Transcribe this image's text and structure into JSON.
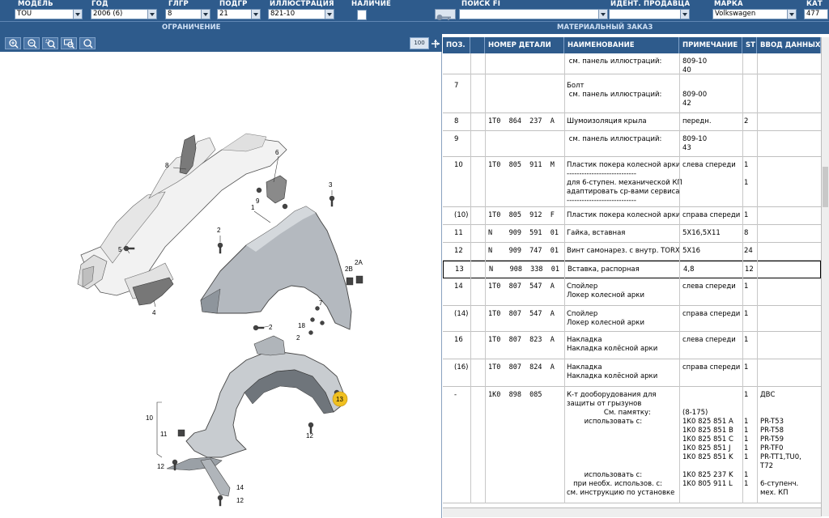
{
  "filters": {
    "model": {
      "label": "МОДЕЛЬ",
      "value": "TOU"
    },
    "year": {
      "label": "ГОД",
      "value": "2006 (6)"
    },
    "group": {
      "label": "ГЛГР",
      "value": "8"
    },
    "subgroup": {
      "label": "ПОДГР",
      "value": "21"
    },
    "illustration": {
      "label": "ИЛЛЮСТРАЦИЯ",
      "value": "821-10"
    },
    "availability": {
      "label": "НАЛИЧИЕ"
    },
    "search_fi": {
      "label": "ПОИСК FI",
      "value": ""
    },
    "seller_id": {
      "label": "ИДЕНТ. ПРОДАВЦА",
      "value": ""
    },
    "brand": {
      "label": "МАРКА",
      "value": "Volkswagen"
    },
    "catalog": {
      "label": "КАТ",
      "value": "477"
    }
  },
  "sections": {
    "left": "ОГРАНИЧЕНИЕ",
    "right": "МАТЕРИАЛЬНЫЙ ЗАКАЗ"
  },
  "zoom_toolbar": {
    "page_indicator": "100"
  },
  "table": {
    "headers": {
      "pos": "ПОЗ.",
      "part": "НОМЕР ДЕТАЛИ",
      "name": "НАИМЕНОВАНИЕ",
      "note": "ПРИМЕЧАНИЕ",
      "qty": "ST",
      "input": "ВВОД ДАННЫХ ПО"
    },
    "rows": [
      {
        "pos": "",
        "part": "",
        "name": " см. панель иллюстраций:",
        "note": "809-10\n40",
        "qty": "",
        "input": ""
      },
      {
        "pos": "7",
        "part": "",
        "name": "Болт\n см. панель иллюстраций:",
        "note": "\n809-00\n42",
        "qty": "",
        "input": ""
      },
      {
        "pos": "8",
        "part": "1T0  864  237  A",
        "name": "Шумоизоляция крыла",
        "note": "передн.",
        "qty": "2",
        "input": ""
      },
      {
        "pos": "9",
        "part": "",
        "name": " см. панель иллюстраций:",
        "note": "809-10\n43",
        "qty": "",
        "input": ""
      },
      {
        "pos": "10",
        "part": "1T0  805  911  M",
        "name": "Пластик покера колесной арки\n----------------------------\nдля 6-ступен. механической КП\nадаптировать ср-вами сервиса\n----------------------------",
        "note": "слева спереди",
        "qty": "1\n\n1",
        "input": ""
      },
      {
        "pos": "(10)",
        "part": "1T0  805  912  F",
        "name": "Пластик покера колесной арки",
        "note": "справа спереди",
        "qty": "1",
        "input": ""
      },
      {
        "pos": "11",
        "part": "N    909  591  01",
        "name": "Гайка, вставная",
        "note": "5X16,5X11",
        "qty": "8",
        "input": ""
      },
      {
        "pos": "12",
        "part": "N    909  747  01",
        "name": "Винт самонарез. с внутр. TORX",
        "note": "5X16",
        "qty": "24",
        "input": ""
      },
      {
        "pos": "13",
        "part": "N    908  338  01",
        "name": "Вставка, распорная",
        "note": "4,8",
        "qty": "12",
        "input": ""
      },
      {
        "pos": "14",
        "part": "1T0  807  547  A",
        "name": "Спойлер\nЛокер колесной арки",
        "note": "слева спереди",
        "qty": "1",
        "input": ""
      },
      {
        "pos": "(14)",
        "part": "1T0  807  547  A",
        "name": "Спойлер\nЛокер колесной арки",
        "note": "справа спереди",
        "qty": "1",
        "input": ""
      },
      {
        "pos": "16",
        "part": "1T0  807  823  A",
        "name": "Накладка\nНакладка колёсной арки",
        "note": "слева спереди",
        "qty": "1",
        "input": ""
      },
      {
        "pos": "(16)",
        "part": "1T0  807  824  A",
        "name": "Накладка\nНакладка колёсной арки",
        "note": "справа спереди",
        "qty": "1",
        "input": ""
      },
      {
        "pos": "-",
        "part": "1K0  898  085",
        "name": "К-т дооборудования для\nзащиты от грызунов\n                 См. памятку:\n        использовать с:\n\n\n\n\n\n        использовать с:\n   при необх. использов. с:\nсм. инструкцию по установке",
        "note": "\n\n(8-175)\n1K0 825 851 A\n1K0 825 851 B\n1K0 825 851 C\n1K0 825 851 J\n1K0 825 851 K\n\n1K0 825 237 K\n1K0 805 911 L",
        "qty": "1\n\n\n1\n1\n1\n1\n1\n\n1\n1",
        "input": "ДВС\n\n\nPR-T53\nPR-T58\nPR-T59\nPR-TF0\nPR-TT1,TU0,\nT72\n\n6-ступенч.\nмех. КП"
      }
    ]
  },
  "callouts": [
    "8",
    "6",
    "3",
    "1",
    "9",
    "5",
    "2",
    "2B",
    "2A",
    "4",
    "7",
    "2",
    "18",
    "2",
    "13",
    "10",
    "11",
    "12",
    "12",
    "14",
    "12"
  ],
  "colors": {
    "header_bg": "#2e5b8c",
    "callout_highlight": "#f0c020"
  }
}
